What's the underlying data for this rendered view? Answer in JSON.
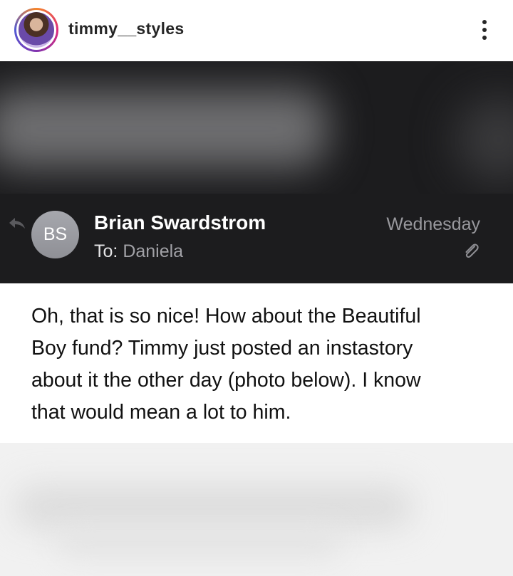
{
  "post_header": {
    "username": "timmy__styles",
    "avatar_icon": "profile-photo",
    "more_icon": "more-options-icon"
  },
  "email": {
    "sender_initials": "BS",
    "sender_name": "Brian Swardstrom",
    "to_label": "To:",
    "to_name": "Daniela",
    "date": "Wednesday",
    "reply_icon": "reply-icon",
    "attachment_icon": "paperclip-icon",
    "body_lines": [
      "Oh, that is so nice!  How about the Beautiful",
      "Boy fund?  Timmy just posted an instastory",
      "about it the other day (photo below).  I know",
      "that would mean a lot to him."
    ]
  },
  "colors": {
    "dark_bg": "#1c1c1e",
    "avatar_gray": "#9a9ba1",
    "muted_text": "#98989d"
  }
}
